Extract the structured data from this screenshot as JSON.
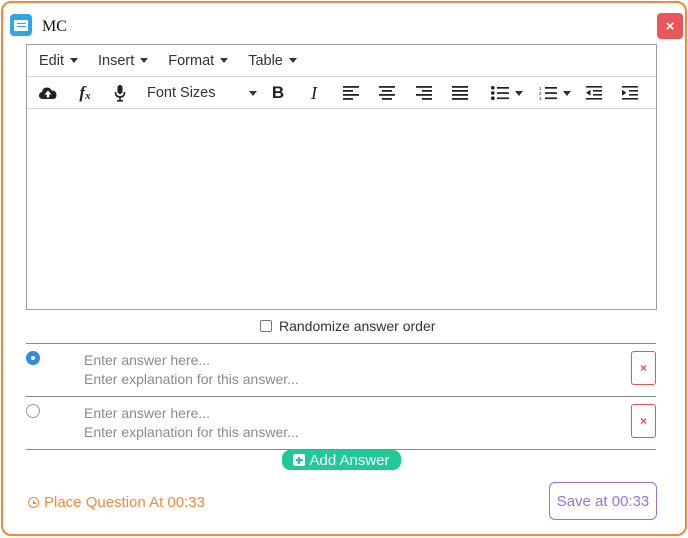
{
  "dialog": {
    "title": "MC",
    "close_label": "×"
  },
  "menubar": {
    "items": [
      {
        "label": "Edit"
      },
      {
        "label": "Insert"
      },
      {
        "label": "Format"
      },
      {
        "label": "Table"
      }
    ]
  },
  "toolbar": {
    "font_sizes_label": "Font Sizes",
    "icons": [
      "upload-icon",
      "formula-icon",
      "microphone-icon",
      "bold-icon",
      "italic-icon",
      "align-left-icon",
      "align-center-icon",
      "align-right-icon",
      "align-justify-icon",
      "bullet-list-icon",
      "numbered-list-icon",
      "outdent-icon",
      "indent-icon"
    ]
  },
  "randomize": {
    "label": "Randomize answer order",
    "checked": false
  },
  "answers": [
    {
      "answer_placeholder": "Enter answer here...",
      "explanation_placeholder": "Enter explanation for this answer...",
      "selected": true,
      "delete_label": "×"
    },
    {
      "answer_placeholder": "Enter answer here...",
      "explanation_placeholder": "Enter explanation for this answer...",
      "selected": false,
      "delete_label": "×"
    }
  ],
  "add_answer_label": "Add Answer",
  "place_question_label": "Place Question At 00:33",
  "save_label": "Save at 00:33",
  "colors": {
    "accent": "#f0883e",
    "add_button": "#20c997",
    "save_button": "#9b6fdc",
    "close_button": "#e8585b",
    "radio_selected": "#2f8be6",
    "delete_button": "#e05555"
  }
}
